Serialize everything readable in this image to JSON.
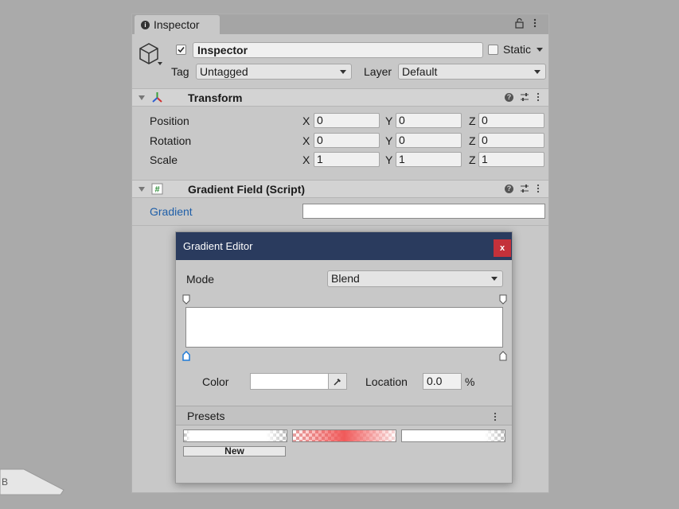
{
  "inspector": {
    "tab_title": "Inspector",
    "object_name": "Inspector",
    "static_label": "Static",
    "tag_label": "Tag",
    "tag_value": "Untagged",
    "layer_label": "Layer",
    "layer_value": "Default"
  },
  "transform": {
    "title": "Transform",
    "rows": [
      {
        "label": "Position",
        "x": "0",
        "y": "0",
        "z": "0"
      },
      {
        "label": "Rotation",
        "x": "0",
        "y": "0",
        "z": "0"
      },
      {
        "label": "Scale",
        "x": "1",
        "y": "1",
        "z": "1"
      }
    ],
    "axis_x": "X",
    "axis_y": "Y",
    "axis_z": "Z"
  },
  "script": {
    "title": "Gradient Field (Script)",
    "gradient_label": "Gradient"
  },
  "gradient_editor": {
    "title": "Gradient Editor",
    "close_glyph": "x",
    "mode_label": "Mode",
    "mode_value": "Blend",
    "color_label": "Color",
    "location_label": "Location",
    "location_value": "0.0",
    "percent": "%",
    "presets_label": "Presets",
    "new_label": "New"
  },
  "colors": {
    "titlebar": "#2a3b5e",
    "close_button": "#c4313a",
    "link_label": "#1f5fa8",
    "preset_red": "#f05a5a"
  }
}
